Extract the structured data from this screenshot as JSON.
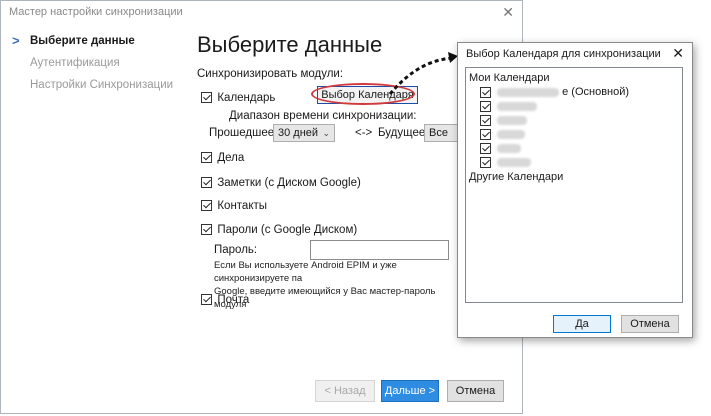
{
  "window": {
    "title": "Мастер настройки синхронизации"
  },
  "sidebar": {
    "items": [
      {
        "label": "Выберите данные"
      },
      {
        "label": "Аутентификация"
      },
      {
        "label": "Настройки Синхронизации"
      }
    ]
  },
  "main": {
    "title": "Выберите данные",
    "sync_modules_label": "Синхронизировать модули:",
    "calendar_label": "Календарь",
    "choose_calendar_button": "Выбор Календаря",
    "time_range_label": "Диапазон времени синхронизации:",
    "past_label": "Прошедшее:",
    "past_value": "30 дней",
    "range_arrow": "<->",
    "future_label": "Будущее:",
    "future_value": "Все",
    "tasks_label": "Дела",
    "notes_label": "Заметки (с Диском Google)",
    "contacts_label": "Контакты",
    "passwords_label": "Пароли (с Google Диском)",
    "password_field_label": "Пароль:",
    "password_note_line1": "Если Вы используете Android EPIM и уже синхронизируете па",
    "password_note_line2": "Google, введите имеющийся у Вас мастер-пароль модуля",
    "mail_label": "Почта"
  },
  "footer": {
    "back": "< Назад",
    "next": "Дальше >",
    "cancel": "Отмена"
  },
  "calendar_dialog": {
    "title": "Выбор Календаря для синхронизации",
    "my_calendars": "Мои Календари",
    "primary_suffix": "е (Основной)",
    "other_calendars": "Другие Календари",
    "ok": "Да",
    "cancel": "Отмена"
  }
}
